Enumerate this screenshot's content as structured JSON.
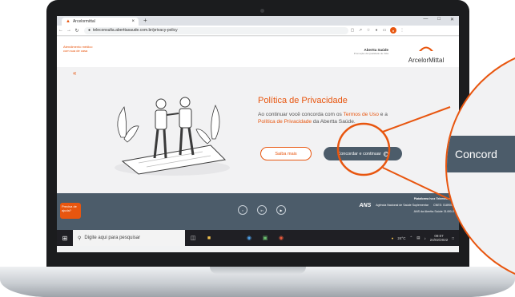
{
  "browser": {
    "tab_title": "Arcelormittal",
    "url": "teleconsulta.aberttasaude.com.br/privacy-policy",
    "window_controls": [
      "—",
      "□",
      "✕"
    ]
  },
  "header": {
    "care_tagline": "Atendimento médico com sua de casa",
    "partner_name": "Abertta Saúde",
    "partner_subtitle": "Promoção da Qualidade de Vida",
    "brand_name": "ArcelorMittal"
  },
  "main": {
    "back_label": "«",
    "title": "Política de Privacidade",
    "text_intro": "Ao continuar você concorda com os ",
    "terms_link": "Termos de Uso",
    "text_and": " e a ",
    "policy_link": "Política de Privacidade",
    "text_brand": " da Abertta Saúde.",
    "learn_more_label": "Saiba mais",
    "continue_label": "Concordar e continuar"
  },
  "footer": {
    "help_label": "Precisa de ajuda?",
    "platform_label": "Plataforma Ivox Telemedicina",
    "ans_logo": "ANS",
    "ans_text": "Agência Nacional de Saúde Suplementar",
    "cnes_label": "CNES: 0189000",
    "ans_registry": "ANS da Abertta Saúde 31490-0",
    "social_icons": [
      "instagram-icon",
      "linkedin-icon",
      "youtube-icon"
    ]
  },
  "taskbar": {
    "search_placeholder": "Digite aqui para pesquisar",
    "weather": "24°C",
    "time": "09:07",
    "date": "24/02/2022"
  },
  "magnifier": {
    "button_text": "Concord"
  },
  "colors": {
    "accent": "#e8560f",
    "slate": "#4c5c6a",
    "background": "#f2f2f3"
  }
}
